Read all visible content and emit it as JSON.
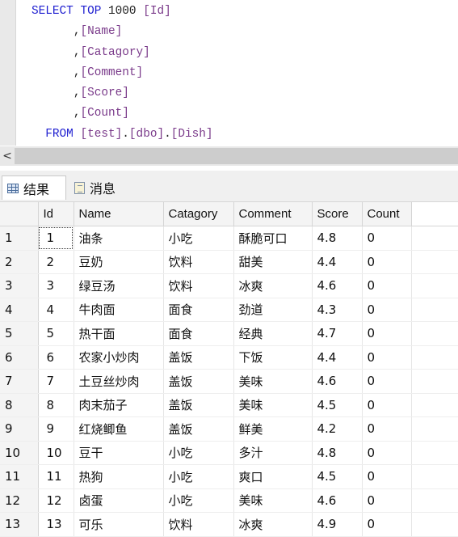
{
  "editor": {
    "lines": [
      [
        [
          "kw",
          "SELECT TOP "
        ],
        [
          "pl",
          "1000 "
        ],
        [
          "br",
          "[Id]"
        ]
      ],
      [
        [
          "pl",
          "      ,"
        ],
        [
          "br",
          "[Name]"
        ]
      ],
      [
        [
          "pl",
          "      ,"
        ],
        [
          "br",
          "[Catagory]"
        ]
      ],
      [
        [
          "pl",
          "      ,"
        ],
        [
          "br",
          "[Comment]"
        ]
      ],
      [
        [
          "pl",
          "      ,"
        ],
        [
          "br",
          "[Score]"
        ]
      ],
      [
        [
          "pl",
          "      ,"
        ],
        [
          "br",
          "[Count]"
        ]
      ],
      [
        [
          "kw",
          "  FROM "
        ],
        [
          "br",
          "[test]"
        ],
        [
          "pl",
          "."
        ],
        [
          "br",
          "[dbo]"
        ],
        [
          "pl",
          "."
        ],
        [
          "br",
          "[Dish]"
        ]
      ]
    ]
  },
  "scrollbar": {
    "left_arrow": "<"
  },
  "tabs": {
    "results": "结果",
    "messages": "消息"
  },
  "grid": {
    "columns": [
      "Id",
      "Name",
      "Catagory",
      "Comment",
      "Score",
      "Count"
    ],
    "rows": [
      [
        "1",
        "1",
        "油条",
        "小吃",
        "酥脆可口",
        "4.8",
        "0"
      ],
      [
        "2",
        "2",
        "豆奶",
        "饮料",
        "甜美",
        "4.4",
        "0"
      ],
      [
        "3",
        "3",
        "绿豆汤",
        "饮料",
        "冰爽",
        "4.6",
        "0"
      ],
      [
        "4",
        "4",
        "牛肉面",
        "面食",
        "劲道",
        "4.3",
        "0"
      ],
      [
        "5",
        "5",
        "热干面",
        "面食",
        "经典",
        "4.7",
        "0"
      ],
      [
        "6",
        "6",
        "农家小炒肉",
        "盖饭",
        "下饭",
        "4.4",
        "0"
      ],
      [
        "7",
        "7",
        "土豆丝炒肉",
        "盖饭",
        "美味",
        "4.6",
        "0"
      ],
      [
        "8",
        "8",
        "肉末茄子",
        "盖饭",
        "美味",
        "4.5",
        "0"
      ],
      [
        "9",
        "9",
        "红烧鲫鱼",
        "盖饭",
        "鲜美",
        "4.2",
        "0"
      ],
      [
        "10",
        "10",
        "豆干",
        "小吃",
        "多汁",
        "4.8",
        "0"
      ],
      [
        "11",
        "11",
        "热狗",
        "小吃",
        "爽口",
        "4.5",
        "0"
      ],
      [
        "12",
        "12",
        "卤蛋",
        "小吃",
        "美味",
        "4.6",
        "0"
      ],
      [
        "13",
        "13",
        "可乐",
        "饮料",
        "冰爽",
        "4.9",
        "0"
      ]
    ]
  }
}
